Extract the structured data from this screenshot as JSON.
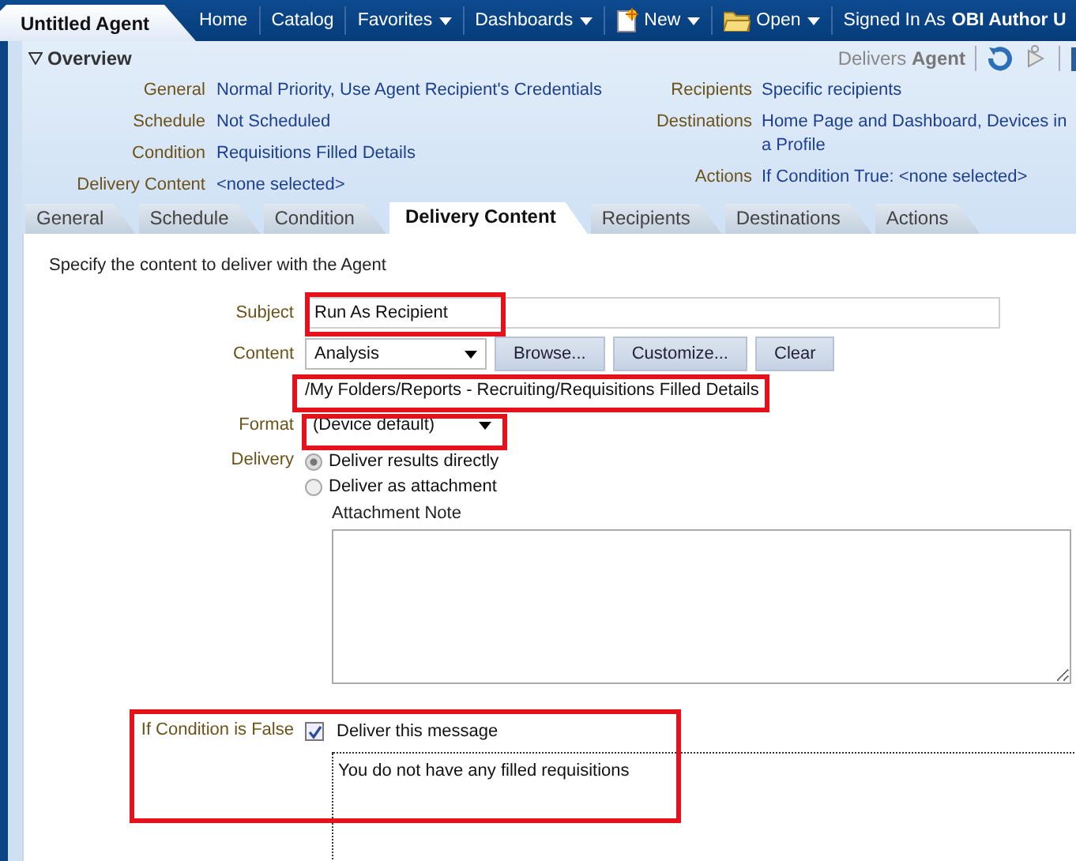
{
  "top_bar": {
    "title": "Untitled Agent",
    "nav": [
      {
        "label": "Home",
        "kind": "link"
      },
      {
        "label": "Catalog",
        "kind": "link"
      },
      {
        "label": "Favorites",
        "kind": "menu"
      },
      {
        "label": "Dashboards",
        "kind": "menu"
      },
      {
        "label": "New",
        "kind": "new-menu"
      },
      {
        "label": "Open",
        "kind": "open-menu"
      }
    ],
    "signed_in_label": "Signed In As",
    "user": "OBI Author U"
  },
  "overview": {
    "title": "Overview",
    "expanded": true,
    "delivers_label": "Delivers",
    "delivers_value": "Agent",
    "left": [
      {
        "label": "General",
        "value": "Normal Priority, Use Agent Recipient's Credentials"
      },
      {
        "label": "Schedule",
        "value": "Not Scheduled"
      },
      {
        "label": "Condition",
        "value": "Requisitions Filled Details"
      },
      {
        "label": "Delivery Content",
        "value": "<none selected>"
      }
    ],
    "right": [
      {
        "label": "Recipients",
        "value": "Specific recipients"
      },
      {
        "label": "Destinations",
        "value": "Home Page and Dashboard, Devices in a Profile"
      },
      {
        "label": "Actions",
        "value": "If Condition True: <none selected>"
      }
    ]
  },
  "tabs": [
    {
      "label": "General",
      "selected": false
    },
    {
      "label": "Schedule",
      "selected": false
    },
    {
      "label": "Condition",
      "selected": false
    },
    {
      "label": "Delivery Content",
      "selected": true
    },
    {
      "label": "Recipients",
      "selected": false
    },
    {
      "label": "Destinations",
      "selected": false
    },
    {
      "label": "Actions",
      "selected": false
    }
  ],
  "form": {
    "intro": "Specify the content to deliver with the Agent",
    "subject": {
      "label": "Subject",
      "value": "Run As Recipient",
      "highlighted": true
    },
    "content": {
      "label": "Content",
      "value": "Analysis",
      "buttons": [
        "Browse...",
        "Customize...",
        "Clear"
      ],
      "path": "/My Folders/Reports - Recruiting/Requisitions Filled Details",
      "path_highlighted": true
    },
    "format": {
      "label": "Format",
      "value": "(Device default)",
      "highlighted": true
    },
    "delivery": {
      "label": "Delivery",
      "options": [
        {
          "label": "Deliver results directly",
          "selected": true
        },
        {
          "label": "Deliver as attachment",
          "selected": false
        }
      ],
      "note_label": "Attachment Note"
    },
    "if_false": {
      "label": "If Condition is False",
      "checkbox_label": "Deliver this message",
      "checked": true,
      "message": "You do not have any filled requisitions",
      "highlighted": true
    }
  }
}
